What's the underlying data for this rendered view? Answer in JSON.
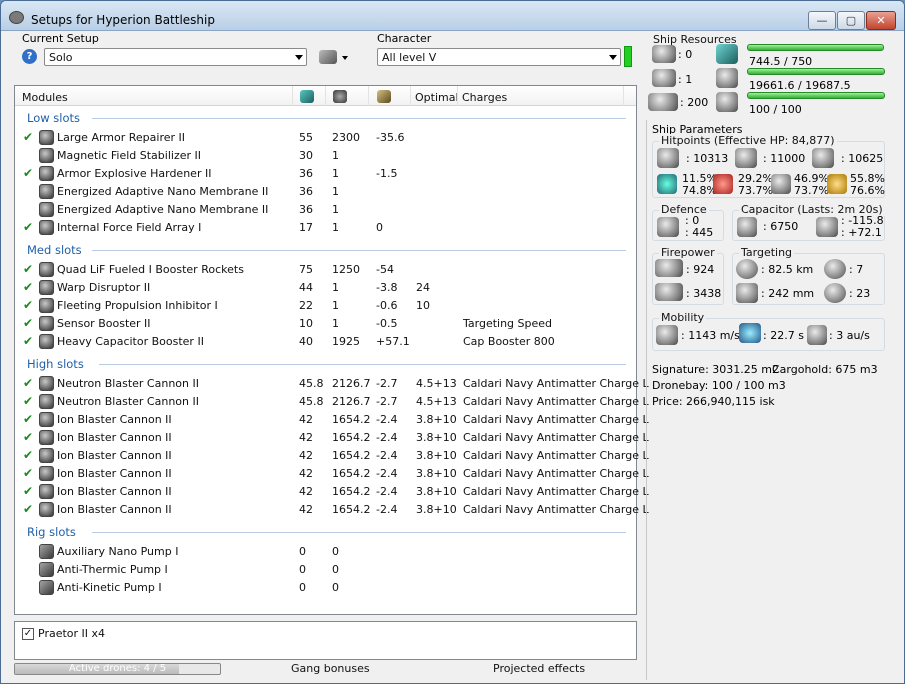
{
  "window": {
    "title": "Setups for Hyperion Battleship",
    "min": "—",
    "max": "▢",
    "close": "✕"
  },
  "setup": {
    "label": "Current Setup",
    "value": "Solo",
    "help": "?"
  },
  "character": {
    "label": "Character",
    "value": "All level V"
  },
  "columns": {
    "modules": "Modules",
    "optimal": "Optimal",
    "charges": "Charges"
  },
  "sections": [
    {
      "label": "Low slots",
      "rows": [
        {
          "checked": true,
          "name": "Large Armor Repairer II",
          "c1": "55",
          "c2": "2300",
          "c3": "-35.6",
          "opt": "",
          "charge": ""
        },
        {
          "checked": false,
          "name": "Magnetic Field Stabilizer II",
          "c1": "30",
          "c2": "1",
          "c3": "",
          "opt": "",
          "charge": ""
        },
        {
          "checked": true,
          "name": "Armor Explosive Hardener II",
          "c1": "36",
          "c2": "1",
          "c3": "-1.5",
          "opt": "",
          "charge": ""
        },
        {
          "checked": false,
          "name": "Energized Adaptive Nano Membrane II",
          "c1": "36",
          "c2": "1",
          "c3": "",
          "opt": "",
          "charge": ""
        },
        {
          "checked": false,
          "name": "Energized Adaptive Nano Membrane II",
          "c1": "36",
          "c2": "1",
          "c3": "",
          "opt": "",
          "charge": ""
        },
        {
          "checked": true,
          "name": "Internal Force Field Array I",
          "c1": "17",
          "c2": "1",
          "c3": "0",
          "opt": "",
          "charge": ""
        }
      ]
    },
    {
      "label": "Med slots",
      "rows": [
        {
          "checked": true,
          "name": "Quad LiF Fueled I Booster Rockets",
          "c1": "75",
          "c2": "1250",
          "c3": "-54",
          "opt": "",
          "charge": ""
        },
        {
          "checked": true,
          "name": "Warp Disruptor II",
          "c1": "44",
          "c2": "1",
          "c3": "-3.8",
          "opt": "24",
          "charge": ""
        },
        {
          "checked": true,
          "name": "Fleeting Propulsion Inhibitor I",
          "c1": "22",
          "c2": "1",
          "c3": "-0.6",
          "opt": "10",
          "charge": ""
        },
        {
          "checked": true,
          "name": "Sensor Booster II",
          "c1": "10",
          "c2": "1",
          "c3": "-0.5",
          "opt": "",
          "charge": "Targeting Speed"
        },
        {
          "checked": true,
          "name": "Heavy Capacitor Booster II",
          "c1": "40",
          "c2": "1925",
          "c3": "+57.1",
          "opt": "",
          "charge": "Cap Booster 800"
        }
      ]
    },
    {
      "label": "High slots",
      "rows": [
        {
          "checked": true,
          "name": "Neutron Blaster Cannon II",
          "c1": "45.8",
          "c2": "2126.7",
          "c3": "-2.7",
          "opt": "4.5+13",
          "charge": "Caldari Navy Antimatter Charge L"
        },
        {
          "checked": true,
          "name": "Neutron Blaster Cannon II",
          "c1": "45.8",
          "c2": "2126.7",
          "c3": "-2.7",
          "opt": "4.5+13",
          "charge": "Caldari Navy Antimatter Charge L"
        },
        {
          "checked": true,
          "name": "Ion Blaster Cannon II",
          "c1": "42",
          "c2": "1654.2",
          "c3": "-2.4",
          "opt": "3.8+10",
          "charge": "Caldari Navy Antimatter Charge L"
        },
        {
          "checked": true,
          "name": "Ion Blaster Cannon II",
          "c1": "42",
          "c2": "1654.2",
          "c3": "-2.4",
          "opt": "3.8+10",
          "charge": "Caldari Navy Antimatter Charge L"
        },
        {
          "checked": true,
          "name": "Ion Blaster Cannon II",
          "c1": "42",
          "c2": "1654.2",
          "c3": "-2.4",
          "opt": "3.8+10",
          "charge": "Caldari Navy Antimatter Charge L"
        },
        {
          "checked": true,
          "name": "Ion Blaster Cannon II",
          "c1": "42",
          "c2": "1654.2",
          "c3": "-2.4",
          "opt": "3.8+10",
          "charge": "Caldari Navy Antimatter Charge L"
        },
        {
          "checked": true,
          "name": "Ion Blaster Cannon II",
          "c1": "42",
          "c2": "1654.2",
          "c3": "-2.4",
          "opt": "3.8+10",
          "charge": "Caldari Navy Antimatter Charge L"
        },
        {
          "checked": true,
          "name": "Ion Blaster Cannon II",
          "c1": "42",
          "c2": "1654.2",
          "c3": "-2.4",
          "opt": "3.8+10",
          "charge": "Caldari Navy Antimatter Charge L"
        }
      ]
    },
    {
      "label": "Rig slots",
      "rows": [
        {
          "checked": false,
          "name": "Auxiliary Nano Pump I",
          "c1": "0",
          "c2": "0",
          "c3": "",
          "opt": "",
          "charge": ""
        },
        {
          "checked": false,
          "name": "Anti-Thermic Pump I",
          "c1": "0",
          "c2": "0",
          "c3": "",
          "opt": "",
          "charge": ""
        },
        {
          "checked": false,
          "name": "Anti-Kinetic Pump I",
          "c1": "0",
          "c2": "0",
          "c3": "",
          "opt": "",
          "charge": ""
        }
      ]
    }
  ],
  "drones": {
    "item": "Praetor II x4",
    "active": "Active drones: 4 / 5",
    "active_fraction": 0.8
  },
  "tabs": {
    "gang": "Gang bonuses",
    "projected": "Projected effects"
  },
  "resources": {
    "title": "Ship Resources",
    "turret": ": 0",
    "launcher": ": 1",
    "calibration": ": 200",
    "cpu": "744.5 / 750",
    "cpu_fraction": 0.993,
    "power": "19661.6 / 19687.5",
    "power_fraction": 0.999,
    "drone_bw": "100 / 100",
    "drone_bw_fraction": 1.0
  },
  "params": {
    "title": "Ship Parameters",
    "hitpoints": "Hitpoints (Effective HP: 84,877)",
    "shield_hp": ": 10313",
    "armor_hp": ": 11000",
    "structure_hp": ": 10625",
    "res": [
      {
        "shield": "11.5%",
        "armor": "74.8%"
      },
      {
        "shield": "29.2%",
        "armor": "73.7%"
      },
      {
        "shield": "46.9%",
        "armor": "73.7%"
      },
      {
        "shield": "55.8%",
        "armor": "76.6%"
      }
    ],
    "defence": {
      "title": "Defence",
      "a": ": 0",
      "b": ": 445"
    },
    "capacitor": {
      "title": "Capacitor (Lasts: 2m 20s)",
      "amount": ": 6750",
      "a": ": -115.8",
      "b": ": +72.1"
    },
    "firepower": {
      "title": "Firepower",
      "a": ": 924",
      "b": ": 3438"
    },
    "targeting": {
      "title": "Targeting",
      "range": ": 82.5 km",
      "targets": ": 7",
      "scan": ": 242 mm",
      "sig": ": 23"
    },
    "mobility": {
      "title": "Mobility",
      "speed": ": 1143 m/s",
      "align": ": 22.7 s",
      "warp": ": 3 au/s"
    },
    "signature": "Signature: 3031.25 m2",
    "cargohold": "Cargohold: 675 m3",
    "dronebay": "Dronebay: 100 / 100 m3",
    "price": "Price: 266,940,115 isk"
  }
}
